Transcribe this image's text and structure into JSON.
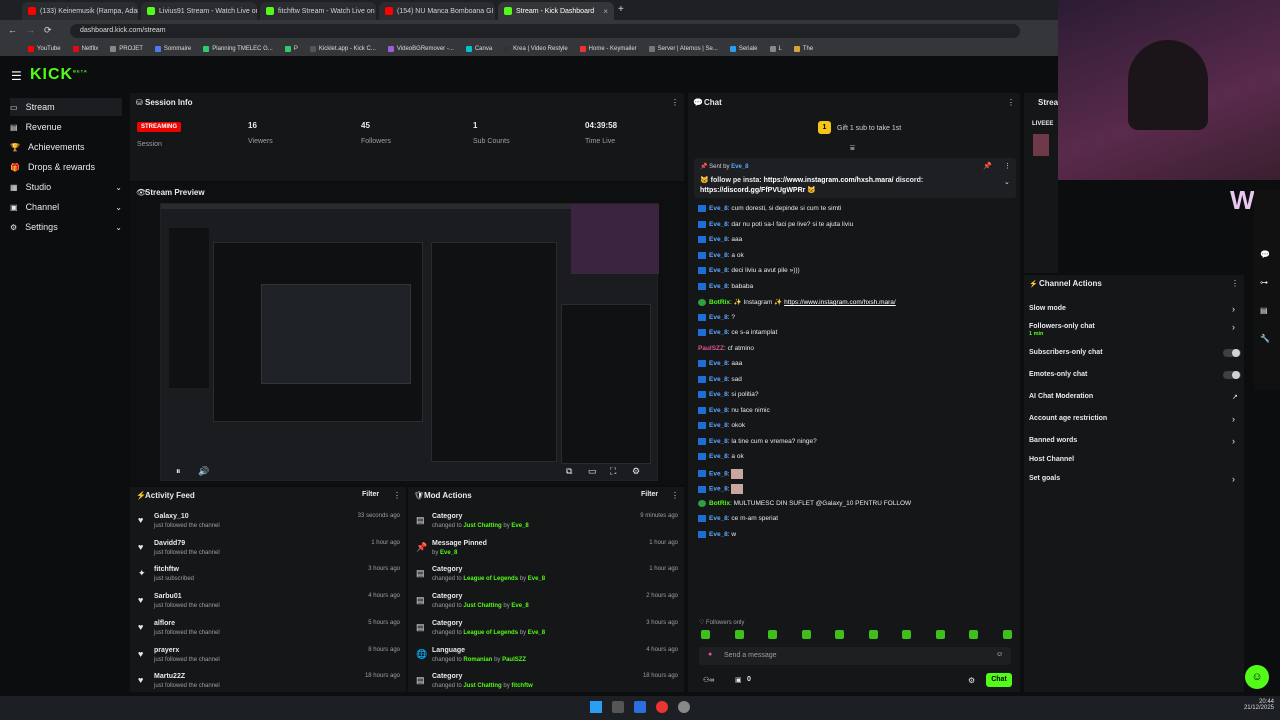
{
  "browser": {
    "tabs": [
      {
        "label": "(133) Keinemusik (Rampa, Adam",
        "color": "#ff0000"
      },
      {
        "label": "Livius91 Stream - Watch Live on",
        "color": "#53fc18"
      },
      {
        "label": "fitchftw Stream - Watch Live on",
        "color": "#53fc18"
      },
      {
        "label": "(154) NU Manca Bomboana GI",
        "color": "#ff0000"
      },
      {
        "label": "Stream - Kick Dashboard",
        "color": "#53fc18"
      }
    ],
    "url": "dashboard.kick.com/stream",
    "bookmarks": [
      "YouTube",
      "Netflix",
      "PROJET",
      "Sommaire",
      "Planning TMELEC G...",
      "P",
      "Kicklet.app - Kick C...",
      "VideoBGRemover -...",
      "Canva",
      "Krea | Video Restyle",
      "Home - Keymailer",
      "Server | Aternos | Se...",
      "Seriale",
      "L",
      "The"
    ]
  },
  "app": {
    "logo": "KICK",
    "logo_sup": "BETA"
  },
  "sidebar": {
    "items": [
      {
        "label": "Stream",
        "icon": "monitor-icon"
      },
      {
        "label": "Revenue",
        "icon": "wallet-icon"
      },
      {
        "label": "Achievements",
        "icon": "trophy-icon"
      },
      {
        "label": "Drops & rewards",
        "icon": "gift-icon"
      },
      {
        "label": "Studio",
        "icon": "studio-icon"
      },
      {
        "label": "Channel",
        "icon": "channel-icon"
      },
      {
        "label": "Settings",
        "icon": "gear-icon"
      }
    ]
  },
  "session": {
    "title": "Session Info",
    "status": "STREAMING",
    "status_label": "Session",
    "viewers": "16",
    "viewers_label": "Viewers",
    "followers": "45",
    "followers_label": "Followers",
    "subs": "1",
    "subs_label": "Sub Counts",
    "time": "04:39:58",
    "time_label": "Time Live"
  },
  "preview": {
    "title": "Stream Preview"
  },
  "activity": {
    "title": "Activity Feed",
    "filter": "Filter",
    "rows": [
      {
        "name": "Galaxy_10",
        "desc": "just followed the channel",
        "time": "33 seconds ago",
        "icon": "heart-icon"
      },
      {
        "name": "Davidd79",
        "desc": "just followed the channel",
        "time": "1 hour ago",
        "icon": "heart-icon"
      },
      {
        "name": "fitchftw",
        "desc": "just subscribed",
        "time": "3 hours ago",
        "icon": "star-icon"
      },
      {
        "name": "Sarbu01",
        "desc": "just followed the channel",
        "time": "4 hours ago",
        "icon": "heart-icon"
      },
      {
        "name": "alflore",
        "desc": "just followed the channel",
        "time": "5 hours ago",
        "icon": "heart-icon"
      },
      {
        "name": "prayerx",
        "desc": "just followed the channel",
        "time": "8 hours ago",
        "icon": "heart-icon"
      },
      {
        "name": "Martu22Z",
        "desc": "just followed the channel",
        "time": "18 hours ago",
        "icon": "heart-icon"
      }
    ]
  },
  "mod": {
    "title": "Mod Actions",
    "filter": "Filter",
    "rows": [
      {
        "name": "Category",
        "desc": "changed to",
        "value": "Just Chatting",
        "by": "by",
        "user": "Eve_8",
        "time": "9 minutes ago"
      },
      {
        "name": "Message Pinned",
        "desc": "",
        "value": "",
        "by": "by",
        "user": "Eve_8",
        "time": "1 hour ago"
      },
      {
        "name": "Category",
        "desc": "changed to",
        "value": "League of Legends",
        "by": "by",
        "user": "Eve_8",
        "time": "1 hour ago"
      },
      {
        "name": "Category",
        "desc": "changed to",
        "value": "Just Chatting",
        "by": "by",
        "user": "Eve_8",
        "time": "2 hours ago"
      },
      {
        "name": "Category",
        "desc": "changed to",
        "value": "League of Legends",
        "by": "by",
        "user": "Eve_8",
        "time": "3 hours ago"
      },
      {
        "name": "Language",
        "desc": "changed to",
        "value": "Romanian",
        "by": "by",
        "user": "PaulSZZ",
        "time": "4 hours ago"
      },
      {
        "name": "Category",
        "desc": "changed to",
        "value": "Just Chatting",
        "by": "by",
        "user": "fitchftw",
        "time": "18 hours ago"
      }
    ]
  },
  "chat": {
    "title": "Chat",
    "gift_count": "1",
    "gift_text": "Gift 1 sub to take 1st",
    "pinned_by_label": "Sent by",
    "pinned_user": "Eve_8",
    "pinned_text": "follow pe insta:",
    "pinned_link1": "https://www.instagram.com/hxsh.mara/",
    "pinned_mid": "discord:",
    "pinned_link2": "https://discord.gg/FfPVUgWPRr",
    "messages": [
      {
        "user": "Eve_8",
        "text": "cum doresti, si depinde si cum te simti",
        "kind": "user"
      },
      {
        "user": "Eve_8",
        "text": "dar nu poti sa-l faci pe live? si te ajuta liviu",
        "kind": "user"
      },
      {
        "user": "Eve_8",
        "text": "aaa",
        "kind": "user"
      },
      {
        "user": "Eve_8",
        "text": "a ok",
        "kind": "user"
      },
      {
        "user": "Eve_8",
        "text": "deci liviu a avut pile »)))",
        "kind": "user"
      },
      {
        "user": "Eve_8",
        "text": "bababa",
        "kind": "user"
      },
      {
        "user": "BotRix",
        "text": "✨ Instagram ✨",
        "link": "https://www.instagram.com/hxsh.mara/",
        "kind": "bot"
      },
      {
        "user": "Eve_8",
        "text": "?",
        "kind": "user"
      },
      {
        "user": "Eve_8",
        "text": "ce s-a intamplat",
        "kind": "user"
      },
      {
        "user": "PaulSZZ",
        "text": "cf atmino",
        "kind": "pink"
      },
      {
        "user": "Eve_8",
        "text": "aaa",
        "kind": "user"
      },
      {
        "user": "Eve_8",
        "text": "sad",
        "kind": "user"
      },
      {
        "user": "Eve_8",
        "text": "si politia?",
        "kind": "user"
      },
      {
        "user": "Eve_8",
        "text": "nu face nimic",
        "kind": "user"
      },
      {
        "user": "Eve_8",
        "text": "okok",
        "kind": "user"
      },
      {
        "user": "Eve_8",
        "text": "la tine cum e vremea? ninge?",
        "kind": "user"
      },
      {
        "user": "Eve_8",
        "text": "a ok",
        "kind": "user"
      },
      {
        "user": "Eve_8",
        "text": "",
        "kind": "user"
      },
      {
        "user": "Eve_8",
        "text": "",
        "kind": "user"
      },
      {
        "user": "BotRix",
        "text": "MULTUMESC DIN SUFLET @Galaxy_10 PENTRU FOLLOW",
        "kind": "bot"
      },
      {
        "user": "Eve_8",
        "text": "ce m-am speriat",
        "kind": "user"
      },
      {
        "user": "Eve_8",
        "text": "w",
        "kind": "user"
      }
    ],
    "followers_only": "Followers only",
    "input_placeholder": "Send a message",
    "count": "0",
    "send": "Chat"
  },
  "channel_actions": {
    "title": "Channel Actions",
    "items": [
      {
        "label": "Slow mode",
        "control": "arrow"
      },
      {
        "label": "Followers-only chat",
        "sub": "1 min",
        "control": "arrow"
      },
      {
        "label": "Subscribers-only chat",
        "control": "toggle"
      },
      {
        "label": "Emotes-only chat",
        "control": "toggle"
      },
      {
        "label": "AI Chat Moderation",
        "control": "external"
      },
      {
        "label": "Account age restriction",
        "control": "arrow"
      },
      {
        "label": "Banned words",
        "control": "arrow"
      },
      {
        "label": "Host Channel",
        "control": "none"
      },
      {
        "label": "Set goals",
        "control": "arrow"
      }
    ]
  },
  "right_partial": {
    "title": "Strea",
    "live_label": "LIVEEE"
  },
  "taskbar": {
    "time": "20:44",
    "date": "21/12/2025"
  },
  "colors": {
    "accent": "#53fc18",
    "live": "#eb0400",
    "panel": "#141618"
  }
}
